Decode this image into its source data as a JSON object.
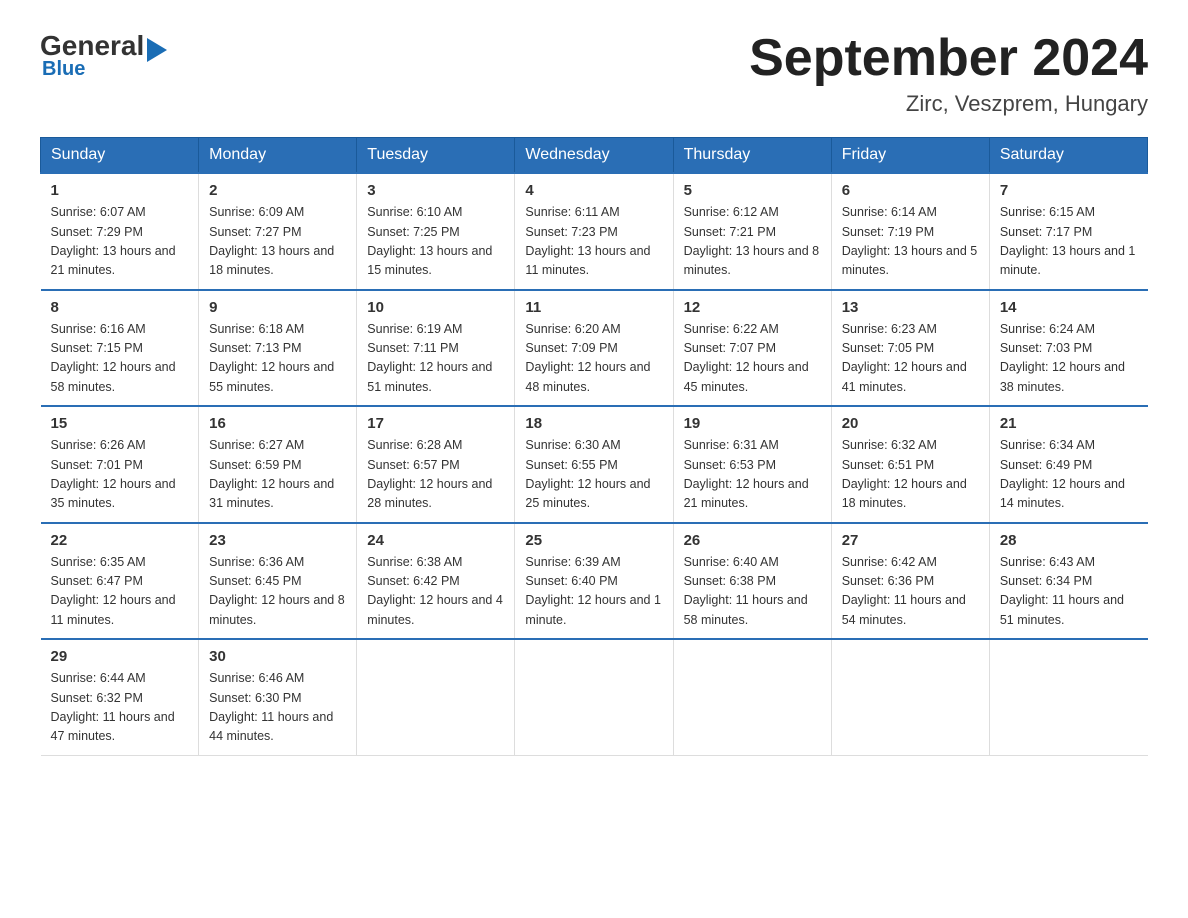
{
  "header": {
    "logo": {
      "general": "General",
      "arrow_symbol": "▶",
      "blue": "Blue"
    },
    "title": "September 2024",
    "subtitle": "Zirc, Veszprem, Hungary"
  },
  "weekdays": [
    "Sunday",
    "Monday",
    "Tuesday",
    "Wednesday",
    "Thursday",
    "Friday",
    "Saturday"
  ],
  "weeks": [
    [
      {
        "day": "1",
        "sunrise": "6:07 AM",
        "sunset": "7:29 PM",
        "daylight": "13 hours and 21 minutes."
      },
      {
        "day": "2",
        "sunrise": "6:09 AM",
        "sunset": "7:27 PM",
        "daylight": "13 hours and 18 minutes."
      },
      {
        "day": "3",
        "sunrise": "6:10 AM",
        "sunset": "7:25 PM",
        "daylight": "13 hours and 15 minutes."
      },
      {
        "day": "4",
        "sunrise": "6:11 AM",
        "sunset": "7:23 PM",
        "daylight": "13 hours and 11 minutes."
      },
      {
        "day": "5",
        "sunrise": "6:12 AM",
        "sunset": "7:21 PM",
        "daylight": "13 hours and 8 minutes."
      },
      {
        "day": "6",
        "sunrise": "6:14 AM",
        "sunset": "7:19 PM",
        "daylight": "13 hours and 5 minutes."
      },
      {
        "day": "7",
        "sunrise": "6:15 AM",
        "sunset": "7:17 PM",
        "daylight": "13 hours and 1 minute."
      }
    ],
    [
      {
        "day": "8",
        "sunrise": "6:16 AM",
        "sunset": "7:15 PM",
        "daylight": "12 hours and 58 minutes."
      },
      {
        "day": "9",
        "sunrise": "6:18 AM",
        "sunset": "7:13 PM",
        "daylight": "12 hours and 55 minutes."
      },
      {
        "day": "10",
        "sunrise": "6:19 AM",
        "sunset": "7:11 PM",
        "daylight": "12 hours and 51 minutes."
      },
      {
        "day": "11",
        "sunrise": "6:20 AM",
        "sunset": "7:09 PM",
        "daylight": "12 hours and 48 minutes."
      },
      {
        "day": "12",
        "sunrise": "6:22 AM",
        "sunset": "7:07 PM",
        "daylight": "12 hours and 45 minutes."
      },
      {
        "day": "13",
        "sunrise": "6:23 AM",
        "sunset": "7:05 PM",
        "daylight": "12 hours and 41 minutes."
      },
      {
        "day": "14",
        "sunrise": "6:24 AM",
        "sunset": "7:03 PM",
        "daylight": "12 hours and 38 minutes."
      }
    ],
    [
      {
        "day": "15",
        "sunrise": "6:26 AM",
        "sunset": "7:01 PM",
        "daylight": "12 hours and 35 minutes."
      },
      {
        "day": "16",
        "sunrise": "6:27 AM",
        "sunset": "6:59 PM",
        "daylight": "12 hours and 31 minutes."
      },
      {
        "day": "17",
        "sunrise": "6:28 AM",
        "sunset": "6:57 PM",
        "daylight": "12 hours and 28 minutes."
      },
      {
        "day": "18",
        "sunrise": "6:30 AM",
        "sunset": "6:55 PM",
        "daylight": "12 hours and 25 minutes."
      },
      {
        "day": "19",
        "sunrise": "6:31 AM",
        "sunset": "6:53 PM",
        "daylight": "12 hours and 21 minutes."
      },
      {
        "day": "20",
        "sunrise": "6:32 AM",
        "sunset": "6:51 PM",
        "daylight": "12 hours and 18 minutes."
      },
      {
        "day": "21",
        "sunrise": "6:34 AM",
        "sunset": "6:49 PM",
        "daylight": "12 hours and 14 minutes."
      }
    ],
    [
      {
        "day": "22",
        "sunrise": "6:35 AM",
        "sunset": "6:47 PM",
        "daylight": "12 hours and 11 minutes."
      },
      {
        "day": "23",
        "sunrise": "6:36 AM",
        "sunset": "6:45 PM",
        "daylight": "12 hours and 8 minutes."
      },
      {
        "day": "24",
        "sunrise": "6:38 AM",
        "sunset": "6:42 PM",
        "daylight": "12 hours and 4 minutes."
      },
      {
        "day": "25",
        "sunrise": "6:39 AM",
        "sunset": "6:40 PM",
        "daylight": "12 hours and 1 minute."
      },
      {
        "day": "26",
        "sunrise": "6:40 AM",
        "sunset": "6:38 PM",
        "daylight": "11 hours and 58 minutes."
      },
      {
        "day": "27",
        "sunrise": "6:42 AM",
        "sunset": "6:36 PM",
        "daylight": "11 hours and 54 minutes."
      },
      {
        "day": "28",
        "sunrise": "6:43 AM",
        "sunset": "6:34 PM",
        "daylight": "11 hours and 51 minutes."
      }
    ],
    [
      {
        "day": "29",
        "sunrise": "6:44 AM",
        "sunset": "6:32 PM",
        "daylight": "11 hours and 47 minutes."
      },
      {
        "day": "30",
        "sunrise": "6:46 AM",
        "sunset": "6:30 PM",
        "daylight": "11 hours and 44 minutes."
      },
      null,
      null,
      null,
      null,
      null
    ]
  ],
  "labels": {
    "sunrise": "Sunrise:",
    "sunset": "Sunset:",
    "daylight": "Daylight:"
  }
}
